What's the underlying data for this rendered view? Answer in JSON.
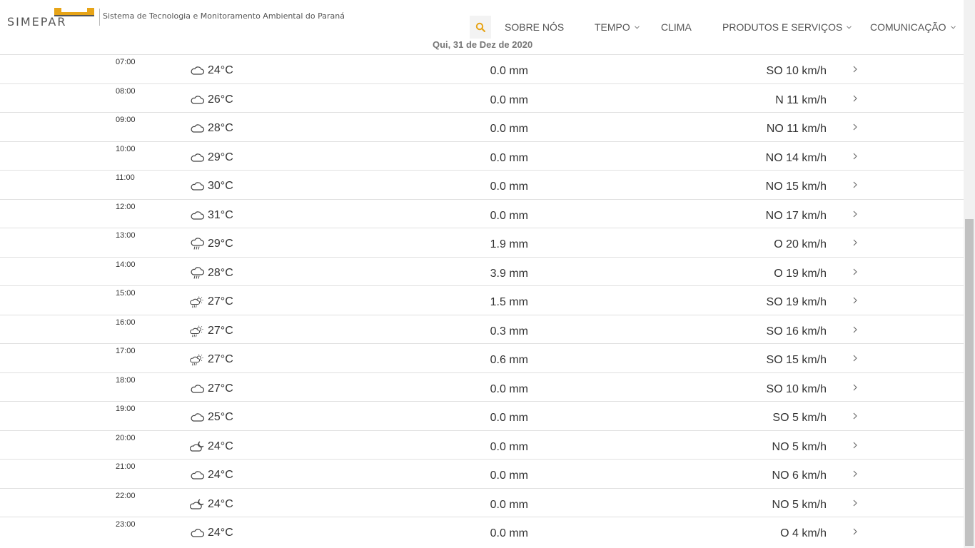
{
  "header": {
    "logo_text": "SIMEPAR",
    "tagline": "Sistema de Tecnologia e Monitoramento Ambiental do Paraná",
    "accent_color": "#e7a417"
  },
  "nav": {
    "items": [
      {
        "label": "SOBRE NÓS",
        "has_dropdown": false
      },
      {
        "label": "TEMPO",
        "has_dropdown": true
      },
      {
        "label": "CLIMA",
        "has_dropdown": false
      },
      {
        "label": "PRODUTOS E SERVIÇOS",
        "has_dropdown": true
      },
      {
        "label": "COMUNICAÇÃO",
        "has_dropdown": true
      }
    ]
  },
  "date_label": "Qui, 31 de Dez de 2020",
  "rows": [
    {
      "time": "07:00",
      "icon": "cloud-icon",
      "temp": "24°C",
      "rain": "0.0 mm",
      "wind": "SO 10 km/h"
    },
    {
      "time": "08:00",
      "icon": "cloud-icon",
      "temp": "26°C",
      "rain": "0.0 mm",
      "wind": "N 11 km/h"
    },
    {
      "time": "09:00",
      "icon": "cloud-icon",
      "temp": "28°C",
      "rain": "0.0 mm",
      "wind": "NO 11 km/h"
    },
    {
      "time": "10:00",
      "icon": "cloud-icon",
      "temp": "29°C",
      "rain": "0.0 mm",
      "wind": "NO 14 km/h"
    },
    {
      "time": "11:00",
      "icon": "cloud-icon",
      "temp": "30°C",
      "rain": "0.0 mm",
      "wind": "NO 15 km/h"
    },
    {
      "time": "12:00",
      "icon": "cloud-icon",
      "temp": "31°C",
      "rain": "0.0 mm",
      "wind": "NO 17 km/h"
    },
    {
      "time": "13:00",
      "icon": "rain-cloud-icon",
      "temp": "29°C",
      "rain": "1.9 mm",
      "wind": "O 20 km/h"
    },
    {
      "time": "14:00",
      "icon": "rain-cloud-icon",
      "temp": "28°C",
      "rain": "3.9 mm",
      "wind": "O 19 km/h"
    },
    {
      "time": "15:00",
      "icon": "sun-rain-icon",
      "temp": "27°C",
      "rain": "1.5 mm",
      "wind": "SO 19 km/h"
    },
    {
      "time": "16:00",
      "icon": "sun-rain-icon",
      "temp": "27°C",
      "rain": "0.3 mm",
      "wind": "SO 16 km/h"
    },
    {
      "time": "17:00",
      "icon": "sun-rain-icon",
      "temp": "27°C",
      "rain": "0.6 mm",
      "wind": "SO 15 km/h"
    },
    {
      "time": "18:00",
      "icon": "cloud-icon",
      "temp": "27°C",
      "rain": "0.0 mm",
      "wind": "SO 10 km/h"
    },
    {
      "time": "19:00",
      "icon": "cloud-icon",
      "temp": "25°C",
      "rain": "0.0 mm",
      "wind": "SO 5 km/h"
    },
    {
      "time": "20:00",
      "icon": "moon-cloud-icon",
      "temp": "24°C",
      "rain": "0.0 mm",
      "wind": "NO 5 km/h"
    },
    {
      "time": "21:00",
      "icon": "cloud-icon",
      "temp": "24°C",
      "rain": "0.0 mm",
      "wind": "NO 6 km/h"
    },
    {
      "time": "22:00",
      "icon": "moon-cloud-icon",
      "temp": "24°C",
      "rain": "0.0 mm",
      "wind": "NO 5 km/h"
    },
    {
      "time": "23:00",
      "icon": "cloud-icon",
      "temp": "24°C",
      "rain": "0.0 mm",
      "wind": "O 4 km/h"
    }
  ]
}
